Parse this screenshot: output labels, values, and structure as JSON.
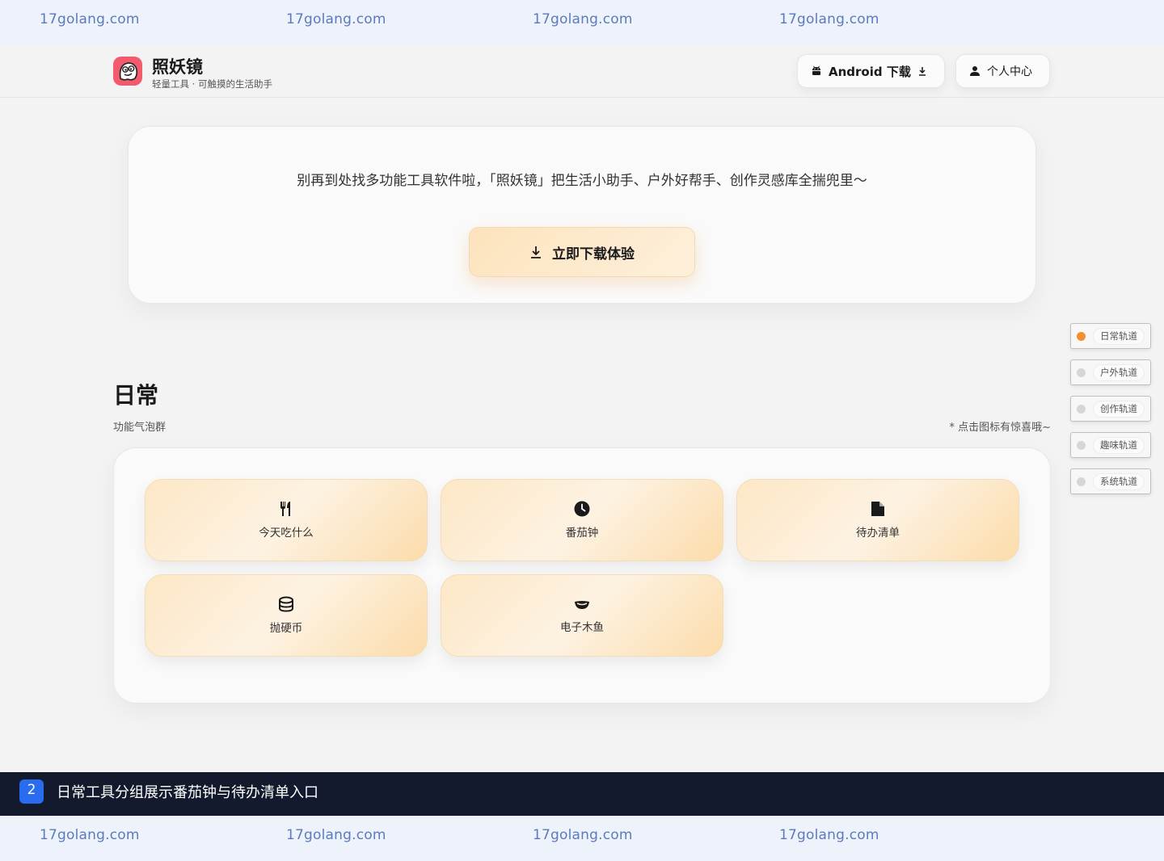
{
  "watermark": {
    "text": "17golang.com"
  },
  "header": {
    "app_name": "照妖镜",
    "tagline": "轻量工具 · 可触摸的生活助手",
    "android_label": "Android 下载",
    "profile_label": "个人中心"
  },
  "hero": {
    "description": "别再到处找多功能工具软件啦，「照妖镜」把生活小助手、户外好帮手、创作灵感库全揣兜里～",
    "cta_label": "立即下载体验"
  },
  "daily_section": {
    "title": "日常",
    "subtitle": "功能气泡群",
    "hint": "* 点击图标有惊喜哦~",
    "tools": [
      {
        "label": "今天吃什么",
        "icon": "utensils-icon"
      },
      {
        "label": "番茄钟",
        "icon": "clock-icon"
      },
      {
        "label": "待办清单",
        "icon": "file-icon"
      },
      {
        "label": "抛硬币",
        "icon": "coin-stack-icon"
      },
      {
        "label": "电子木鱼",
        "icon": "wooden-fish-icon"
      }
    ]
  },
  "side_nav": {
    "items": [
      {
        "label": "日常轨道",
        "active": true
      },
      {
        "label": "户外轨道",
        "active": false
      },
      {
        "label": "创作轨道",
        "active": false
      },
      {
        "label": "趣味轨道",
        "active": false
      },
      {
        "label": "系统轨道",
        "active": false
      }
    ]
  },
  "caption": {
    "index": "2",
    "text": "日常工具分组展示番茄钟与待办清单入口"
  },
  "colors": {
    "accent": "#f29030",
    "tool_bg": "#fde7c6",
    "caption_bg": "#141a2e",
    "badge_bg": "#2a6cf0"
  }
}
